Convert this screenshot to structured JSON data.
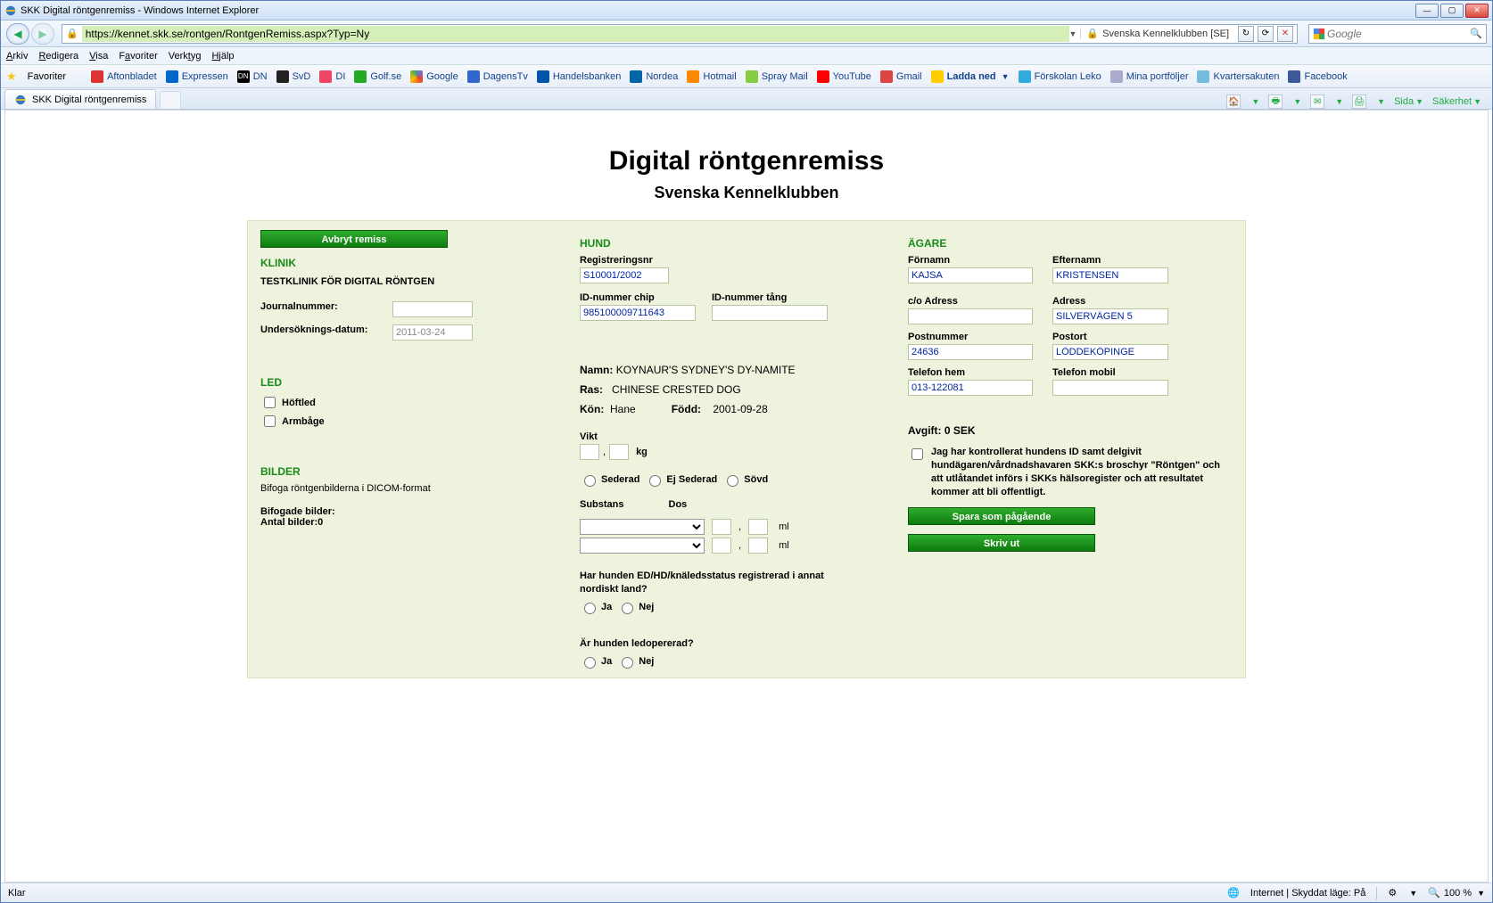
{
  "window": {
    "title": "SKK Digital röntgenremiss - Windows Internet Explorer"
  },
  "nav": {
    "url": "https://kennet.skk.se/rontgen/RontgenRemiss.aspx?Typ=Ny",
    "identity": "Svenska Kennelklubben [SE]",
    "search_placeholder": "Google"
  },
  "menus": {
    "m1": "Arkiv",
    "m2": "Redigera",
    "m3": "Visa",
    "m4": "Favoriter",
    "m5": "Verktyg",
    "m6": "Hjälp"
  },
  "favbar": {
    "label": "Favoriter",
    "items": [
      "Aftonbladet",
      "Expressen",
      "DN",
      "SvD",
      "DI",
      "Golf.se",
      "Google",
      "DagensTv",
      "Handelsbanken",
      "Nordea",
      "Hotmail",
      "Spray Mail",
      "YouTube",
      "Gmail",
      "Ladda ned",
      "Förskolan Leko",
      "Mina portföljer",
      "Kvartersakuten",
      "Facebook"
    ]
  },
  "tabs": {
    "active": "SKK Digital röntgenremiss",
    "tool_sida": "Sida",
    "tool_sakerhet": "Säkerhet"
  },
  "page": {
    "title": "Digital röntgenremiss",
    "subtitle": "Svenska Kennelklubben"
  },
  "klinik": {
    "btn_avbryt": "Avbryt remiss",
    "head": "KLINIK",
    "name": "TESTKLINIK FÖR DIGITAL RÖNTGEN",
    "journal_lbl": "Journalnummer:",
    "journal_val": "",
    "date_lbl": "Undersöknings-datum:",
    "date_val": "2011-03-24",
    "led_head": "LED",
    "hoftled": "Höftled",
    "armbage": "Armbåge",
    "bilder_head": "BILDER",
    "bilder_hint": "Bifoga röntgenbilderna i DICOM-format",
    "bifogade_lbl": "Bifogade bilder:",
    "antal_lbl": "Antal bilder:",
    "antal_val": "0"
  },
  "hund": {
    "head": "HUND",
    "reg_lbl": "Registreringsnr",
    "reg_val": "S10001/2002",
    "chip_lbl": "ID-nummer chip",
    "chip_val": "985100009711643",
    "tang_lbl": "ID-nummer tång",
    "tang_val": "",
    "namn_lbl": "Namn:",
    "namn_val": "KOYNAUR'S SYDNEY'S DY-NAMITE",
    "ras_lbl": "Ras:",
    "ras_val": "CHINESE CRESTED DOG",
    "kon_lbl": "Kön:",
    "kon_val": "Hane",
    "fodd_lbl": "Född:",
    "fodd_val": "2001-09-28",
    "vikt_lbl": "Vikt",
    "vikt_unit": "kg",
    "sed_sederad": "Sederad",
    "sed_ej": "Ej Sederad",
    "sed_sovd": "Sövd",
    "subst_lbl": "Substans",
    "dos_lbl": "Dos",
    "dos_unit": "ml",
    "q1": "Har hunden ED/HD/knäledsstatus registrerad i annat nordiskt land?",
    "q2": "Är hunden ledopererad?",
    "ja": "Ja",
    "nej": "Nej"
  },
  "agare": {
    "head": "ÄGARE",
    "fornamn_lbl": "Förnamn",
    "fornamn_val": "KAJSA",
    "efternamn_lbl": "Efternamn",
    "efternamn_val": "KRISTENSEN",
    "co_lbl": "c/o Adress",
    "co_val": "",
    "adress_lbl": "Adress",
    "adress_val": "SILVERVÄGEN 5",
    "postnr_lbl": "Postnummer",
    "postnr_val": "24636",
    "postort_lbl": "Postort",
    "postort_val": "LÖDDEKÖPINGE",
    "telhem_lbl": "Telefon hem",
    "telhem_val": "013-122081",
    "telmob_lbl": "Telefon mobil",
    "telmob_val": "",
    "avgift_lbl": "Avgift:",
    "avgift_val": "0 SEK",
    "consent": "Jag har kontrollerat hundens ID samt delgivit hundägaren/vårdnadshavaren SKK:s broschyr \"Röntgen\" och att utlåtandet införs i SKKs hälsoregister och att resultatet kommer att bli offentligt.",
    "btn_spara": "Spara som pågående",
    "btn_skriv": "Skriv ut"
  },
  "status": {
    "left": "Klar",
    "mode": "Internet | Skyddat läge: På",
    "zoom": "100 %"
  }
}
